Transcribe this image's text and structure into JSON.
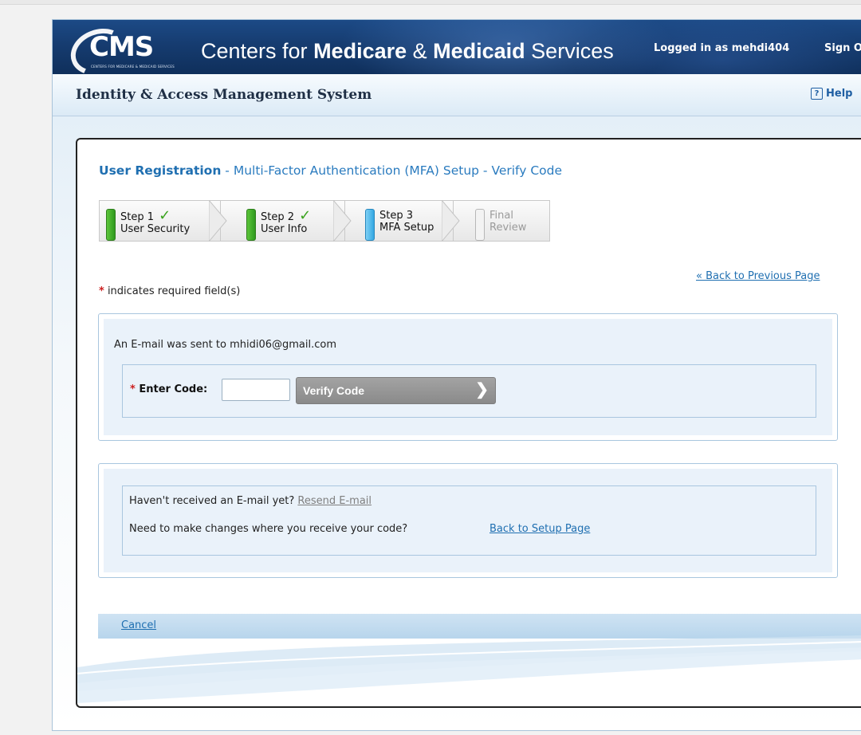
{
  "header": {
    "logo_text": "CMS",
    "logo_subtext": "CENTERS FOR MEDICARE & MEDICAID SERVICES",
    "title_prefix": "Centers for ",
    "title_bold1": "Medicare",
    "title_mid": " & ",
    "title_bold2": "Medicaid",
    "title_suffix": " Services",
    "logged_in": "Logged in as mehdi404",
    "sign_out": "Sign Out"
  },
  "system_bar": {
    "title": "Identity & Access Management System",
    "help_icon": "?",
    "help": "Help"
  },
  "page": {
    "heading_strong": "User Registration",
    "heading_rest": " - Multi-Factor Authentication (MFA) Setup - Verify Code",
    "steps": [
      {
        "line1": "Step 1",
        "line2": "User Security",
        "status": "complete",
        "icon": "checkmark-icon",
        "check_glyph": "✓"
      },
      {
        "line1": "Step 2",
        "line2": "User Info",
        "status": "complete",
        "icon": "checkmark-icon",
        "check_glyph": "✓"
      },
      {
        "line1": "Step 3",
        "line2": "MFA Setup",
        "status": "current"
      },
      {
        "line1": "Final",
        "line2": "Review",
        "status": "pending"
      }
    ],
    "back_link": "« Back to Previous Page",
    "required_star": "*",
    "required_note": " indicates required field(s)",
    "email_notice": "An E-mail was sent to mhidi06@gmail.com",
    "code_star": "*",
    "code_label": " Enter Code:",
    "code_value": "",
    "verify_button": "Verify Code",
    "verify_chevron": "❯",
    "resend_prompt": "Haven't received an E-mail yet? ",
    "resend_link": "Resend E-mail",
    "change_prompt": "Need to make changes where you receive your code?",
    "setup_link": "Back to Setup Page",
    "cancel": "Cancel"
  },
  "colors": {
    "banner": "#163c70",
    "link": "#1f6fb1",
    "step_complete": "#3aa21d",
    "step_current": "#33a7e2",
    "required": "#cc1f1f",
    "button": "#999999"
  }
}
